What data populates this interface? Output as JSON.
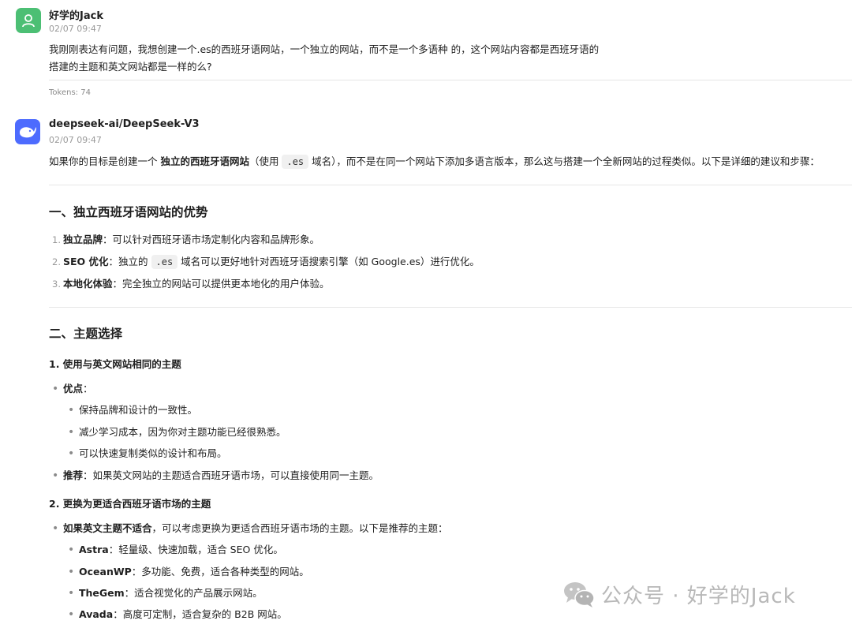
{
  "user_message": {
    "author": "好学的Jack",
    "time": "02/07 09:47",
    "line1": "我刚刚表达有问题，我想创建一个.es的西班牙语网站，一个独立的网站，而不是一个多语种 的，这个网站内容都是西班牙语的",
    "line2": "搭建的主题和英文网站都是一样的么?",
    "tokens": "Tokens: 74"
  },
  "bot_message": {
    "author": "deepseek-ai/DeepSeek-V3",
    "time": "02/07 09:47",
    "intro_a": "如果你的目标是创建一个 ",
    "intro_bold": "独立的西班牙语网站",
    "intro_b": "（使用 ",
    "intro_code": ".es",
    "intro_c": " 域名），而不是在同一个网站下添加多语言版本，那么这与搭建一个全新网站的过程类似。以下是详细的建议和步骤：",
    "section1": {
      "title": "一、独立西班牙语网站的优势",
      "items": [
        {
          "num": "1.",
          "bold": "独立品牌",
          "text": "：可以针对西班牙语市场定制化内容和品牌形象。"
        },
        {
          "num": "2.",
          "bold": "SEO 优化",
          "text_a": "：独立的 ",
          "code": ".es",
          "text_b": " 域名可以更好地针对西班牙语搜索引擎（如 Google.es）进行优化。"
        },
        {
          "num": "3.",
          "bold": "本地化体验",
          "text": "：完全独立的网站可以提供更本地化的用户体验。"
        }
      ]
    },
    "section2": {
      "title": "二、主题选择",
      "sub1": {
        "title": "1. 使用与英文网站相同的主题",
        "pros_label": "优点",
        "pros_colon": "：",
        "pros": [
          "保持品牌和设计的一致性。",
          "减少学习成本，因为你对主题功能已经很熟悉。",
          "可以快速复制类似的设计和布局。"
        ],
        "rec_label": "推荐",
        "rec_text": "：如果英文网站的主题适合西班牙语市场，可以直接使用同一主题。"
      },
      "sub2": {
        "title": "2. 更换为更适合西班牙语市场的主题",
        "lead_bold": "如果英文主题不适合",
        "lead_text": "，可以考虑更换为更适合西班牙语市场的主题。以下是推荐的主题：",
        "themes": [
          {
            "name": "Astra",
            "desc": "：轻量级、快速加载，适合 SEO 优化。"
          },
          {
            "name": "OceanWP",
            "desc": "：多功能、免费，适合各种类型的网站。"
          },
          {
            "name": "TheGem",
            "desc": "：适合视觉化的产品展示网站。"
          },
          {
            "name": "Avada",
            "desc": "：高度可定制，适合复杂的 B2B 网站。"
          }
        ]
      }
    }
  },
  "watermark": {
    "text": "公众号 · 好学的Jack",
    "icon": "wechat-icon"
  },
  "colors": {
    "user_avatar": "#4cbf74",
    "bot_avatar": "#4d6bfe"
  }
}
